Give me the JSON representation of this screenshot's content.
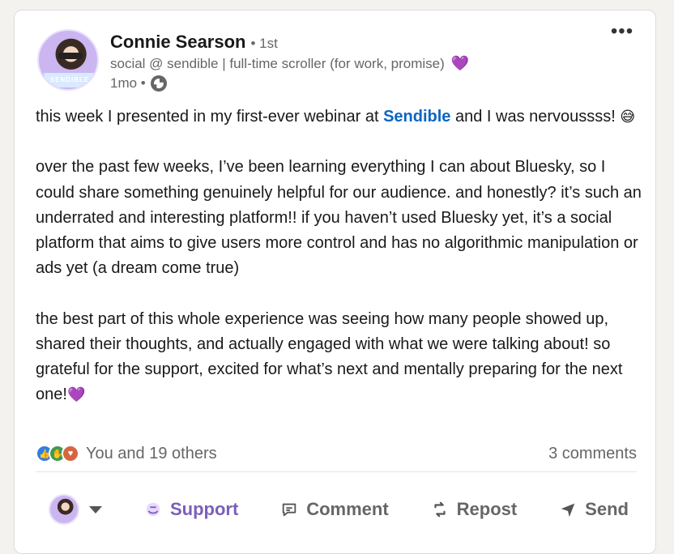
{
  "author": {
    "name": "Connie Searson",
    "degree": "• 1st",
    "headline": "social @ sendible | full-time scroller (for work, promise)",
    "headline_emoji": "💜",
    "time": "1mo •",
    "badge": "SENDIBLE"
  },
  "post": {
    "p1_before": "this week I presented in my first-ever webinar at ",
    "p1_mention": "Sendible",
    "p1_after": " and I was nervoussss!",
    "p1_emoji": "😅",
    "p2": "over the past few weeks, I’ve been learning everything I can about Bluesky, so I could share something genuinely helpful for our audience. and honestly? it’s such an underrated and interesting platform!! if you haven’t used Bluesky yet, it’s a social platform that aims to give users more control and has no algorithmic manipulation or ads yet (a dream come true)",
    "p3": "the best part of this whole experience was seeing how many people showed up, shared their thoughts, and actually engaged with what we were talking about! so grateful for the support, excited for what’s next and mentally preparing for the next one!",
    "p3_emoji": "💜"
  },
  "social": {
    "reactions_text": "You and 19 others",
    "comments_text": "3 comments"
  },
  "actions": {
    "support": "Support",
    "comment": "Comment",
    "repost": "Repost",
    "send": "Send"
  },
  "icons": [
    "more-icon",
    "globe-icon",
    "support-icon",
    "comment-icon",
    "repost-icon",
    "send-icon",
    "caret-down-icon"
  ]
}
